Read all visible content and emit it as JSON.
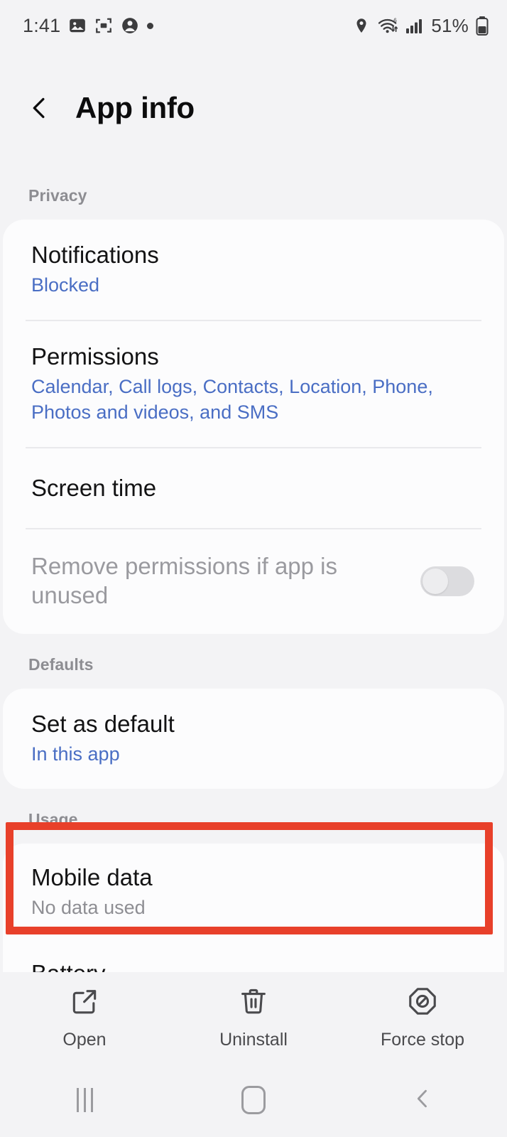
{
  "status_bar": {
    "time": "1:41",
    "battery_percent": "51%",
    "left_icons": [
      "photo-icon",
      "screenshot-scan-icon",
      "account-icon",
      "dot-icon"
    ],
    "right_icons": [
      "location-pin-icon",
      "wifi-6-icon",
      "signal-bars-icon",
      "battery-icon"
    ]
  },
  "header": {
    "back_icon": "back-chevron-icon",
    "title": "App info"
  },
  "sections": [
    {
      "label": "Privacy",
      "rows": [
        {
          "title": "Notifications",
          "subtitle": "Blocked",
          "subtitle_style": "blue"
        },
        {
          "title": "Permissions",
          "subtitle": "Calendar, Call logs, Contacts, Location, Phone, Photos and videos, and SMS",
          "subtitle_style": "blue"
        },
        {
          "title": "Screen time",
          "subtitle": "",
          "subtitle_style": "none"
        },
        {
          "title": "Remove permissions if app is unused",
          "subtitle": "",
          "subtitle_style": "none",
          "disabled": true,
          "toggle": "off"
        }
      ]
    },
    {
      "label": "Defaults",
      "rows": [
        {
          "title": "Set as default",
          "subtitle": "In this app",
          "subtitle_style": "blue"
        }
      ]
    },
    {
      "label": "Usage",
      "rows": [
        {
          "title": "Mobile data",
          "subtitle": "No data used",
          "subtitle_style": "grey",
          "highlighted": true
        },
        {
          "title": "Battery",
          "subtitle": "",
          "subtitle_style": "none"
        }
      ]
    }
  ],
  "highlight": {
    "color": "#e8402a",
    "target": "Mobile data"
  },
  "action_bar": [
    {
      "label": "Open",
      "icon": "open-external-icon"
    },
    {
      "label": "Uninstall",
      "icon": "trash-icon"
    },
    {
      "label": "Force stop",
      "icon": "force-stop-icon"
    }
  ],
  "nav_bar": [
    {
      "name": "recents-button",
      "icon": "recents-icon"
    },
    {
      "name": "home-button",
      "icon": "home-icon"
    },
    {
      "name": "back-button",
      "icon": "back-icon"
    }
  ],
  "colors": {
    "background": "#f3f3f5",
    "card": "#fcfcfd",
    "link_blue": "#4a6ec4",
    "muted": "#8e8e93",
    "highlight_red": "#e8402a"
  }
}
